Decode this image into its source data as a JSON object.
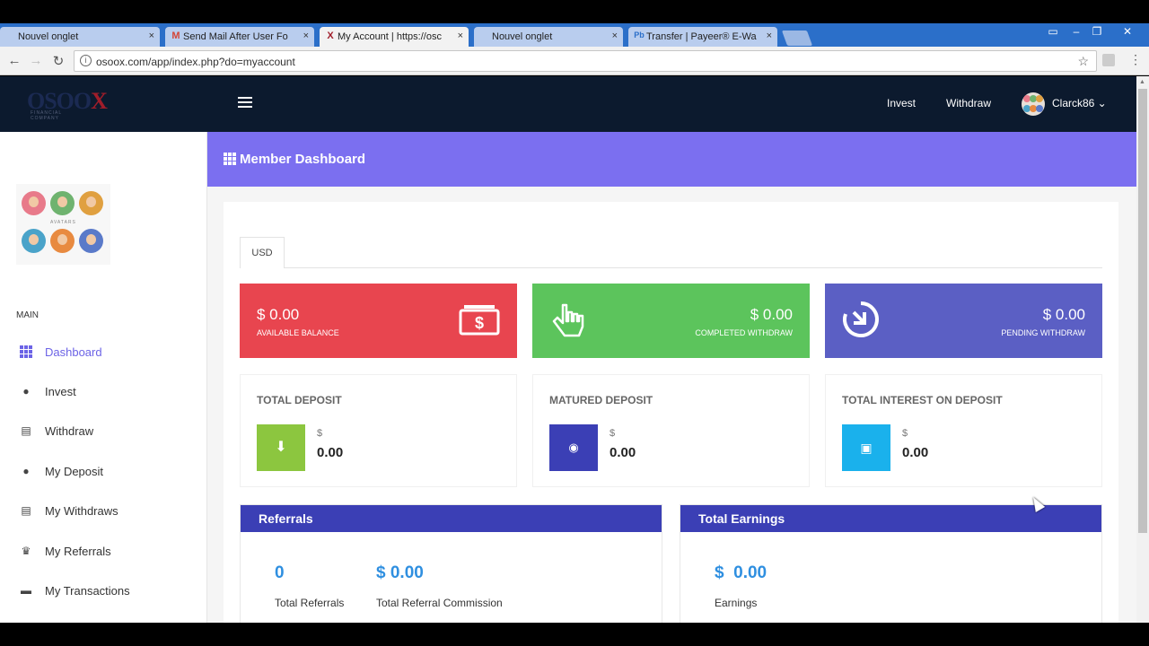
{
  "browser": {
    "tabs": [
      {
        "label": "Nouvel onglet",
        "icon": ""
      },
      {
        "label": "Send Mail After User Fo",
        "icon": "M"
      },
      {
        "label": "My Account | https://osc",
        "icon": "X"
      },
      {
        "label": "Nouvel onglet",
        "icon": ""
      },
      {
        "label": "Transfer | Payeer® E-Wa",
        "icon": "Pb"
      }
    ],
    "url": "osoox.com/app/index.php?do=myaccount",
    "close_glyph": "×"
  },
  "topnav": {
    "logo_text": "OSOO",
    "logo_x": "X",
    "logo_sub": "FINANCIAL COMPANY",
    "links": [
      "Invest",
      "Withdraw"
    ],
    "username": "Clarck86 ⌄"
  },
  "sidebar": {
    "avatars_caption": "AVATARS",
    "section": "MAIN",
    "items": [
      {
        "label": "Dashboard",
        "icon": "grid-icon"
      },
      {
        "label": "Invest",
        "icon": "piggy-bank-icon"
      },
      {
        "label": "Withdraw",
        "icon": "cash-icon"
      },
      {
        "label": "My Deposit",
        "icon": "piggy-bank-icon"
      },
      {
        "label": "My Withdraws",
        "icon": "cash-icon"
      },
      {
        "label": "My Referrals",
        "icon": "crown-icon"
      },
      {
        "label": "My Transactions",
        "icon": "briefcase-icon"
      }
    ]
  },
  "header": {
    "title": "Member Dashboard"
  },
  "dashboard": {
    "currency_tab": "USD",
    "stats": [
      {
        "amount": "$ 0.00",
        "caption": "AVAILABLE BALANCE",
        "color": "#e8454f",
        "icon": "money-icon"
      },
      {
        "amount": "$ 0.00",
        "caption": "COMPLETED WITHDRAW",
        "color": "#5cc45c",
        "icon": "hand-pointer-icon"
      },
      {
        "amount": "$ 0.00",
        "caption": "PENDING WITHDRAW",
        "color": "#5b5fc4",
        "icon": "clock-arrow-icon"
      }
    ],
    "deposits": [
      {
        "title": "TOTAL DEPOSIT",
        "currency": "$",
        "value": "0.00",
        "color": "#8cc63f",
        "icon": "download-icon"
      },
      {
        "title": "MATURED DEPOSIT",
        "currency": "$",
        "value": "0.00",
        "color": "#3b3fb5",
        "icon": "coins-icon"
      },
      {
        "title": "TOTAL INTEREST ON DEPOSIT",
        "currency": "$",
        "value": "0.00",
        "color": "#1ab1ec",
        "icon": "bill-icon"
      }
    ],
    "referrals": {
      "title": "Referrals",
      "count": "0",
      "count_label": "Total Referrals",
      "commission": "$ 0.00",
      "commission_label": "Total Referral Commission"
    },
    "earnings": {
      "title": "Total Earnings",
      "amount": "$  0.00",
      "label": "Earnings"
    }
  },
  "colors": {
    "accent": "#7b6ff0",
    "nav_bg": "#0c1a2e",
    "card_blue": "#3b3fb5",
    "number_blue": "#2f8fe0"
  }
}
